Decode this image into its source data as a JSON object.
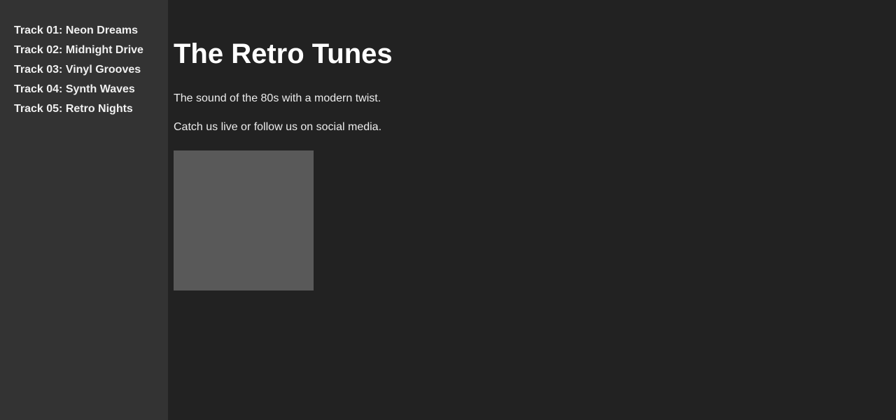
{
  "sidebar": {
    "tracks": [
      {
        "label": "Track 01: Neon Dreams"
      },
      {
        "label": "Track 02: Midnight Drive"
      },
      {
        "label": "Track 03: Vinyl Grooves"
      },
      {
        "label": "Track 04: Synth Waves"
      },
      {
        "label": "Track 05: Retro Nights"
      }
    ]
  },
  "main": {
    "title": "The Retro Tunes",
    "tagline": "The sound of the 80s with a modern twist.",
    "cta": "Catch us live or follow us on social media."
  },
  "colors": {
    "page_background": "#222222",
    "sidebar_background": "#333333",
    "image_placeholder": "#595959",
    "text": "#ffffff"
  }
}
